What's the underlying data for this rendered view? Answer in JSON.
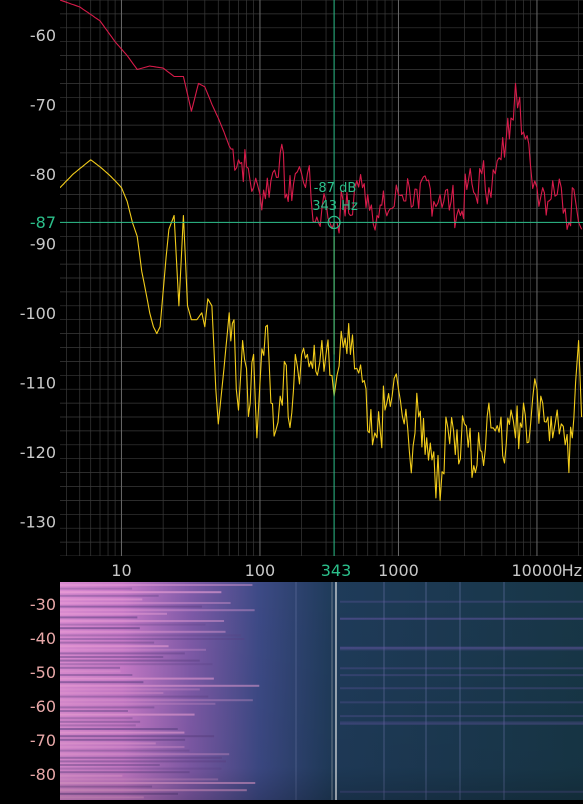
{
  "colors": {
    "background": "#000000",
    "grid_major": "#6a6a6a",
    "grid_minor": "#3a3a3a",
    "tick_text": "#c8c8c8",
    "peak_series": "#d81b4a",
    "spectrum_series": "#f2cc1a",
    "cursor": "#2bbf8a",
    "spectrogram_label": "#e8a8a8"
  },
  "cursor": {
    "db_label": "-87 dB",
    "hz_label": "343 Hz",
    "y_axis_marker": "-87",
    "x_axis_marker": "343",
    "frequency": 343,
    "level": -87
  },
  "spectrogram": {
    "y_ticks": [
      "-30",
      "-40",
      "-50",
      "-60",
      "-70",
      "-80"
    ]
  },
  "chart_data": {
    "type": "line",
    "xscale": "log",
    "xlim": [
      3.6,
      21500
    ],
    "ylim": [
      -135,
      -55
    ],
    "grid": true,
    "x_ticks": [
      {
        "value": 10,
        "label": "10"
      },
      {
        "value": 100,
        "label": "100"
      },
      {
        "value": 1000,
        "label": "1000"
      },
      {
        "value": 10000,
        "label": "10000"
      }
    ],
    "x_unit_label": "Hz",
    "y_ticks": [
      {
        "value": -60,
        "label": "-60"
      },
      {
        "value": -70,
        "label": "-70"
      },
      {
        "value": -80,
        "label": "-80"
      },
      {
        "value": -90,
        "label": "-90"
      },
      {
        "value": -100,
        "label": "-100"
      },
      {
        "value": -110,
        "label": "-110"
      },
      {
        "value": -120,
        "label": "-120"
      },
      {
        "value": -130,
        "label": "-130"
      }
    ],
    "series": [
      {
        "color": "#d81b4a",
        "x": [
          3.6,
          5,
          7,
          9,
          11,
          13,
          16,
          20,
          24,
          28,
          32,
          36,
          40,
          45,
          50,
          55,
          60,
          70,
          80,
          90,
          100,
          120,
          140,
          160,
          180,
          200,
          220,
          250,
          280,
          300,
          320,
          343,
          360,
          400,
          450,
          500,
          550,
          600,
          700,
          800,
          900,
          1000,
          1200,
          1400,
          1600,
          1800,
          2000,
          2400,
          2800,
          3200,
          3600,
          4000,
          4500,
          5000,
          5500,
          6000,
          6500,
          7000,
          7500,
          8000,
          9000,
          10000,
          11000,
          12000,
          13000,
          14000,
          15000,
          16000,
          17000,
          18000,
          19000,
          20000,
          21000
        ],
        "y": [
          -55,
          -56,
          -58,
          -61,
          -63,
          -65,
          -64.5,
          -64.8,
          -66,
          -66,
          -71,
          -67,
          -67.5,
          -70,
          -72,
          -74,
          -76,
          -78,
          -79,
          -82,
          -83,
          -81,
          -77,
          -84,
          -80,
          -80,
          -80,
          -87,
          -85,
          -84,
          -87,
          -87,
          -87,
          -84,
          -86,
          -81,
          -82,
          -83,
          -86,
          -85,
          -85,
          -83,
          -82,
          -85,
          -81,
          -84,
          -83,
          -84,
          -86,
          -81,
          -83,
          -80,
          -82,
          -80,
          -78,
          -75,
          -72,
          -67,
          -69,
          -74,
          -79,
          -82,
          -82,
          -84,
          -81,
          -83,
          -82,
          -85,
          -87,
          -82,
          -84,
          -87,
          -88
        ]
      },
      {
        "color": "#f2cc1a",
        "x": [
          3.6,
          4.5,
          6,
          7,
          8,
          9,
          10,
          11,
          12,
          13,
          14,
          15,
          16,
          17,
          18,
          19,
          20,
          21,
          22,
          24,
          26,
          28,
          30,
          32,
          35,
          38,
          40,
          42,
          45,
          48,
          50,
          55,
          60,
          65,
          70,
          75,
          80,
          85,
          90,
          95,
          100,
          110,
          120,
          130,
          140,
          150,
          160,
          180,
          200,
          220,
          240,
          260,
          280,
          300,
          320,
          343,
          360,
          400,
          450,
          500,
          550,
          600,
          650,
          700,
          800,
          900,
          1000,
          1100,
          1200,
          1400,
          1600,
          1800,
          2000,
          2200,
          2500,
          2800,
          3000,
          3500,
          4000,
          4500,
          5000,
          5500,
          6000,
          6500,
          7000,
          8000,
          9000,
          10000,
          11000,
          12000,
          13000,
          14000,
          15000,
          16000,
          17000,
          18000,
          19000,
          20000,
          21000
        ],
        "y": [
          -82,
          -80,
          -78,
          -79,
          -80,
          -81,
          -82,
          -84,
          -87,
          -89,
          -94,
          -97,
          -100,
          -102,
          -103,
          -102,
          -97,
          -92,
          -88,
          -86,
          -99,
          -86,
          -99,
          -101,
          -101,
          -100,
          -102,
          -98,
          -99,
          -111,
          -116,
          -108,
          -100,
          -101,
          -114,
          -104,
          -108,
          -113,
          -106,
          -118,
          -110,
          -102,
          -113,
          -117,
          -112,
          -107,
          -115,
          -106,
          -106,
          -106,
          -108,
          -109,
          -104,
          -106,
          -109,
          -112,
          -109,
          -105,
          -106,
          -108,
          -110,
          -117,
          -119,
          -118,
          -114,
          -112,
          -111,
          -116,
          -120,
          -115,
          -118,
          -120,
          -127,
          -115,
          -117,
          -121,
          -116,
          -122,
          -120,
          -113,
          -117,
          -115,
          -119,
          -114,
          -118,
          -113,
          -116,
          -111,
          -113,
          -115,
          -118,
          -114,
          -116,
          -119,
          -123,
          -118,
          -110,
          -104,
          -115
        ]
      }
    ]
  }
}
